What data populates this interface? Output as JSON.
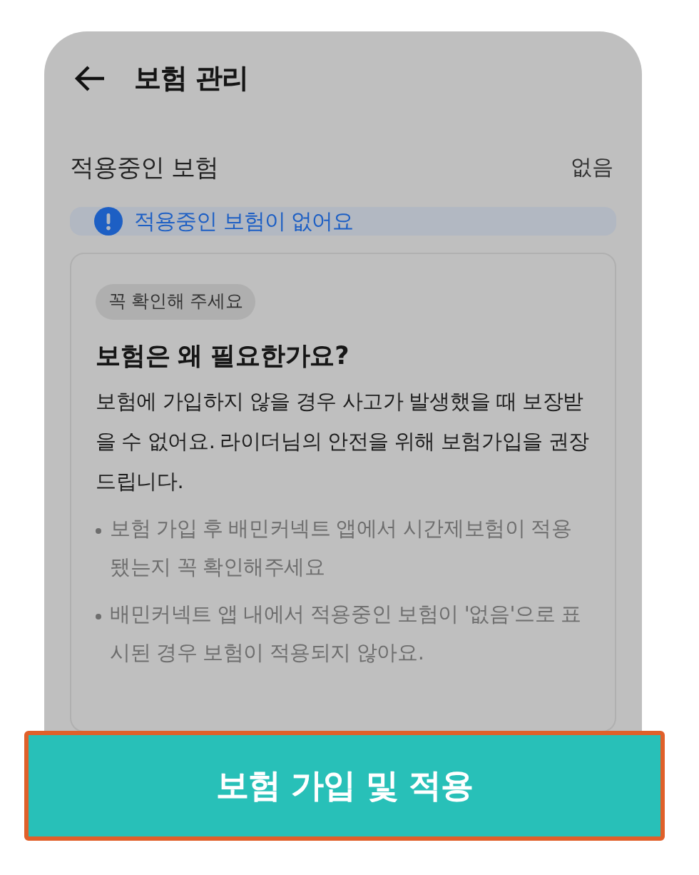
{
  "header": {
    "title": "보험 관리"
  },
  "status_row": {
    "label": "적용중인 보험",
    "value": "없음"
  },
  "notice": {
    "text": "적용중인 보험이 없어요"
  },
  "info_card": {
    "chip": "꼭 확인해 주세요",
    "heading": "보험은 왜 필요한가요?",
    "body": "보험에 가입하지 않을 경우 사고가 발생했을 때 보장받을 수 없어요. 라이더님의 안전을 위해 보험가입을 권장드립니다.",
    "bullets": [
      "보험 가입 후 배민커넥트 앱에서 시간제보험이 적용됐는지 꼭 확인해주세요",
      "배민커넥트 앱 내에서 적용중인 보험이 '없음'으로 표시된 경우 보험이 적용되지 않아요."
    ]
  },
  "primary_button": {
    "label": "보험 가입 및 적용"
  }
}
